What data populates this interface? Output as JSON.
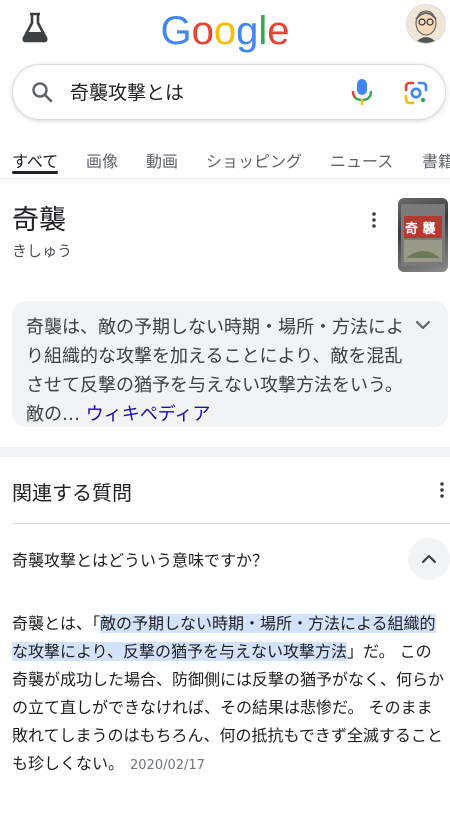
{
  "header": {
    "logo_letters": [
      "G",
      "o",
      "o",
      "g",
      "l",
      "e"
    ],
    "logo_colors": [
      "#4285F4",
      "#EA4335",
      "#FBBC05",
      "#4285F4",
      "#34A853",
      "#EA4335"
    ]
  },
  "search": {
    "value": "奇襲攻撃とは"
  },
  "tabs": [
    {
      "label": "すべて",
      "active": true
    },
    {
      "label": "画像"
    },
    {
      "label": "動画"
    },
    {
      "label": "ショッピング"
    },
    {
      "label": "ニュース"
    },
    {
      "label": "書籍"
    }
  ],
  "knowledge": {
    "title": "奇襲",
    "reading": "きしゅう",
    "image_text": "奇 襲",
    "description": "奇襲は、敵の予期しない時期・場所・方法により組織的な攻撃を加えることにより、敵を混乱させて反撃の猶予を与えない攻撃方法をいう。敵の…",
    "description_link": "ウィキペディア"
  },
  "related": {
    "title": "関連する質問",
    "question": "奇襲攻撃とはどういう意味ですか？",
    "answer_prefix": "奇襲とは、「",
    "answer_highlight": "敵の予期しない時期・場所・方法による組織的な攻撃により、反撃の猶予を与えない攻撃方法",
    "answer_suffix": "」だ。 この奇襲が成功した場合、防御側には反撃の猶予がなく、何らかの立て直しができなければ、その結果は悲惨だ。 そのまま敗れてしまうのはもちろん、何の抵抗もできず全滅することも珍しくない。",
    "date": "2020/02/17"
  },
  "colors": {
    "accent": "#1a73e8",
    "link": "#1a0dab"
  }
}
